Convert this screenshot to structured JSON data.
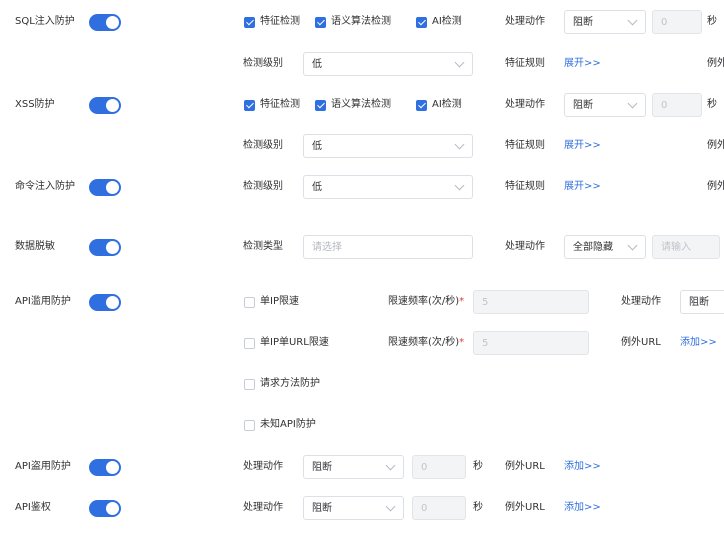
{
  "common": {
    "action_label": "处理动作",
    "level_label": "检测级别",
    "feature_rule_label": "特征规则",
    "expand_link": "展开>>",
    "add_link": "添加>>",
    "seconds": "秒",
    "exclude_url_label": "例外URL",
    "exclude_truncated": "例外",
    "block": "阻断",
    "low": "低",
    "feature_detect": "特征检测",
    "semantic_detect": "语义算法检测",
    "ai_detect": "AI检测",
    "seconds_placeholder": "0"
  },
  "rows": {
    "sqli": {
      "name": "SQL注入防护",
      "enabled": true
    },
    "xss": {
      "name": "XSS防护",
      "enabled": true
    },
    "cmd": {
      "name": "命令注入防护",
      "enabled": true
    },
    "mask": {
      "name": "数据脱敏",
      "enabled": true,
      "type_label": "检测类型",
      "type_placeholder": "请选择",
      "action_value": "全部隐藏",
      "input_placeholder": "请输入"
    },
    "abuse": {
      "name": "API滥用防护",
      "enabled": true,
      "single_ip": "单IP限速",
      "single_ip_url": "单IP单URL限速",
      "method_protect": "请求方法防护",
      "unknown_api": "未知API防护",
      "rate_label": "限速频率(次/秒)",
      "rate_star": "*",
      "rate_value": "5",
      "action_value": "阻断"
    },
    "theft": {
      "name": "API盗用防护",
      "enabled": true
    },
    "auth": {
      "name": "API鉴权",
      "enabled": true
    }
  }
}
